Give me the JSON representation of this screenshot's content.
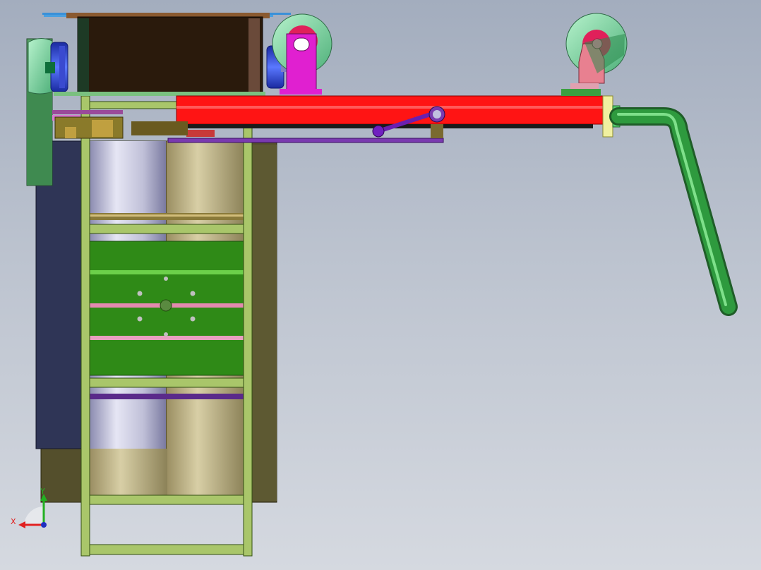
{
  "viewport": {
    "background_top": "#a3adbe",
    "background_bottom": "#d5d9e0"
  },
  "triad": {
    "x_label": "X",
    "y_label": "Y",
    "x_color": "#e02020",
    "y_color": "#22b022",
    "z_color": "#2030c0"
  },
  "colors": {
    "frame": "#a9c66a",
    "frame_edge": "#334f12",
    "main_beam": "#ff1414",
    "handle_pipe": "#2e9a3e",
    "tank_steel": "#c8c8dc",
    "tank_brass": "#c7b98b",
    "green_panel": "#2f8a17",
    "dark_box": "#2a1a0c",
    "left_plate": "#2f3556",
    "back_plate": "#54502e",
    "pulley": "#7fe0a8",
    "bracket_magenta": "#e020d0",
    "bracket_pink": "#e88090",
    "lever": "#6a20b0",
    "motor_blue": "#2040e0"
  }
}
